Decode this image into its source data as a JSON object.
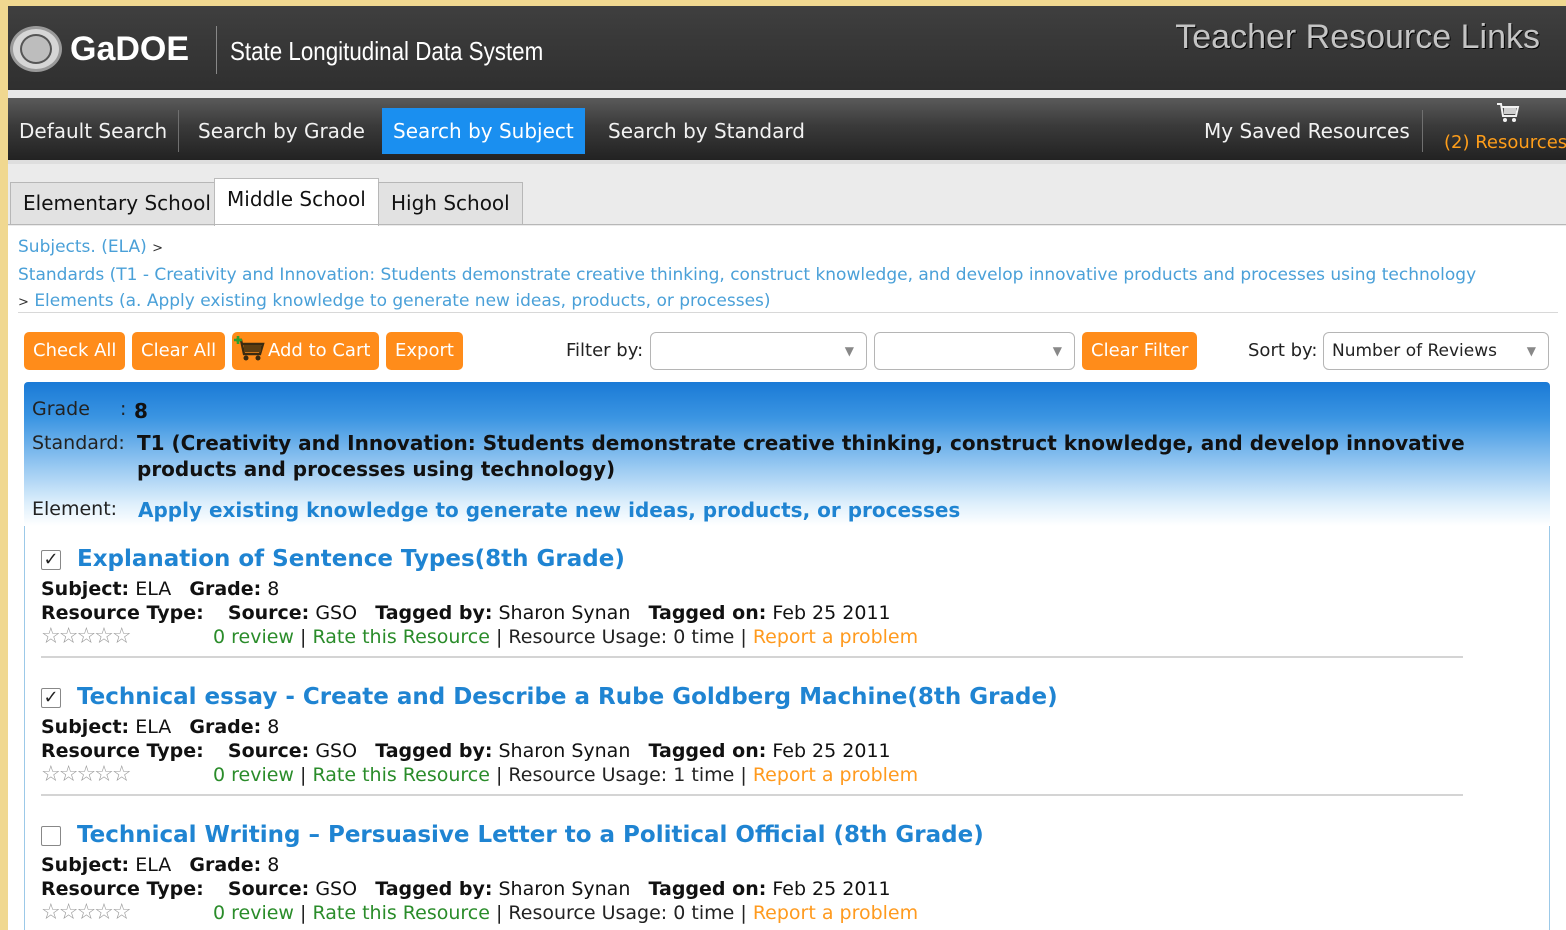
{
  "header": {
    "brand": "GaDOE",
    "system_name": "State Longitudinal Data System",
    "title": "Teacher Resource Links"
  },
  "nav": {
    "items": [
      {
        "label": "Default Search"
      },
      {
        "label": "Search by Grade"
      },
      {
        "label": "Search by Subject"
      },
      {
        "label": "Search by Standard"
      }
    ],
    "active": "Search by Subject",
    "saved": "My Saved Resources",
    "cart_label": "(2) Resources"
  },
  "tabs": [
    "Elementary School",
    "Middle School",
    "High School"
  ],
  "active_tab": "Middle School",
  "breadcrumb": {
    "subjects": "Subjects. (ELA)",
    "standards": "Standards (T1 - Creativity and Innovation: Students demonstrate creative thinking, construct knowledge, and develop innovative products and processes using technology",
    "elements": "Elements (a. Apply existing knowledge to generate new ideas, products, or processes)",
    "separator": ">"
  },
  "toolbar": {
    "check_all": "Check All",
    "clear_all": "Clear All",
    "add_to_cart": "Add to Cart",
    "export": "Export",
    "filter_label": "Filter by:",
    "filter1_value": "",
    "filter2_value": "",
    "clear_filter": "Clear Filter",
    "sort_label": "Sort by:",
    "sort_value": "Number of Reviews"
  },
  "info": {
    "grade_label": "Grade",
    "grade_colon": ":",
    "grade_value": "8",
    "standard_label": "Standard:",
    "standard_value": "T1 (Creativity and Innovation: Students demonstrate creative thinking, construct knowledge, and develop innovative products and processes using technology)",
    "element_label": "Element:",
    "element_value": "Apply existing knowledge to generate new ideas, products, or processes"
  },
  "labels": {
    "subject": "Subject:",
    "grade": "Grade:",
    "resource_type": "Resource Type:",
    "source": "Source:",
    "tagged_by": "Tagged by:",
    "tagged_on": "Tagged on:",
    "rate": "Rate this Resource",
    "usage": "Resource Usage:",
    "report": "Report a problem",
    "sep": "|"
  },
  "resources": [
    {
      "checked": true,
      "title": "Explanation of Sentence Types(8th Grade)",
      "subject": "ELA",
      "grade": "8",
      "source": "GSO",
      "tagged_by": "Sharon Synan",
      "tagged_on": "Feb 25 2011",
      "reviews": "0 review",
      "usage": "0 time"
    },
    {
      "checked": true,
      "title": "Technical essay - Create and Describe a Rube Goldberg Machine(8th Grade)",
      "subject": "ELA",
      "grade": "8",
      "source": "GSO",
      "tagged_by": "Sharon Synan",
      "tagged_on": "Feb 25 2011",
      "reviews": "0 review",
      "usage": "1 time"
    },
    {
      "checked": false,
      "title": "Technical Writing – Persuasive Letter to a Political Official (8th Grade)",
      "subject": "ELA",
      "grade": "8",
      "source": "GSO",
      "tagged_by": "Sharon Synan",
      "tagged_on": "Feb 25 2011",
      "reviews": "0 review",
      "usage": "0 time"
    }
  ],
  "colors": {
    "accent_blue": "#1a8ff0",
    "orange": "#ff8c1a",
    "link_blue": "#1f84d2",
    "green": "#2a8c2a"
  }
}
